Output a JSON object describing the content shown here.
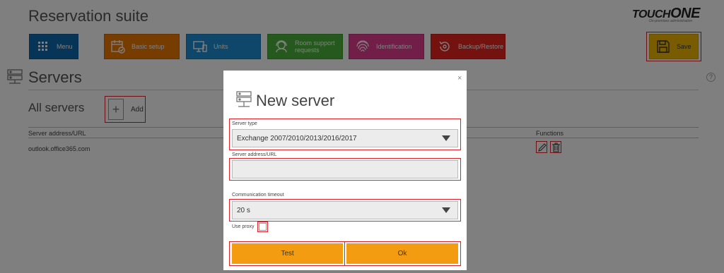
{
  "app": {
    "title": "Reservation suite",
    "brand_main": "TOUCH",
    "brand_one": "ONE",
    "brand_sub": "On-premises administration"
  },
  "toolbar": {
    "menu_label": "Menu",
    "basic_setup_label": "Basic setup",
    "units_label": "Units",
    "room_support_label": "Room support requests",
    "identification_label": "Identification",
    "backup_label": "Backup/Restore",
    "save_label": "Save"
  },
  "section": {
    "title": "Servers",
    "help": "?",
    "subtitle": "All servers",
    "add_label": "Add"
  },
  "table": {
    "columns": [
      "Server address/URL",
      "Functions"
    ],
    "rows": [
      {
        "address": "outlook.office365.com"
      }
    ]
  },
  "dialog": {
    "title": "New server",
    "close": "×",
    "server_type_label": "Server type",
    "server_type_value": "Exchange 2007/2010/2013/2016/2017",
    "server_address_label": "Server address/URL",
    "server_address_value": "",
    "timeout_label": "Communication timeout",
    "timeout_value": "20 s",
    "use_proxy_label": "Use proxy",
    "use_proxy_checked": false,
    "test_label": "Test",
    "ok_label": "Ok"
  },
  "colors": {
    "menu": "#0f6ab1",
    "basic_setup": "#ee7a00",
    "units": "#1e8ed6",
    "room_support": "#4db33c",
    "identification": "#e23e91",
    "backup": "#e8251e",
    "save": "#f5b800",
    "dialog_button": "#f39c11",
    "highlight": "#e0202a"
  }
}
